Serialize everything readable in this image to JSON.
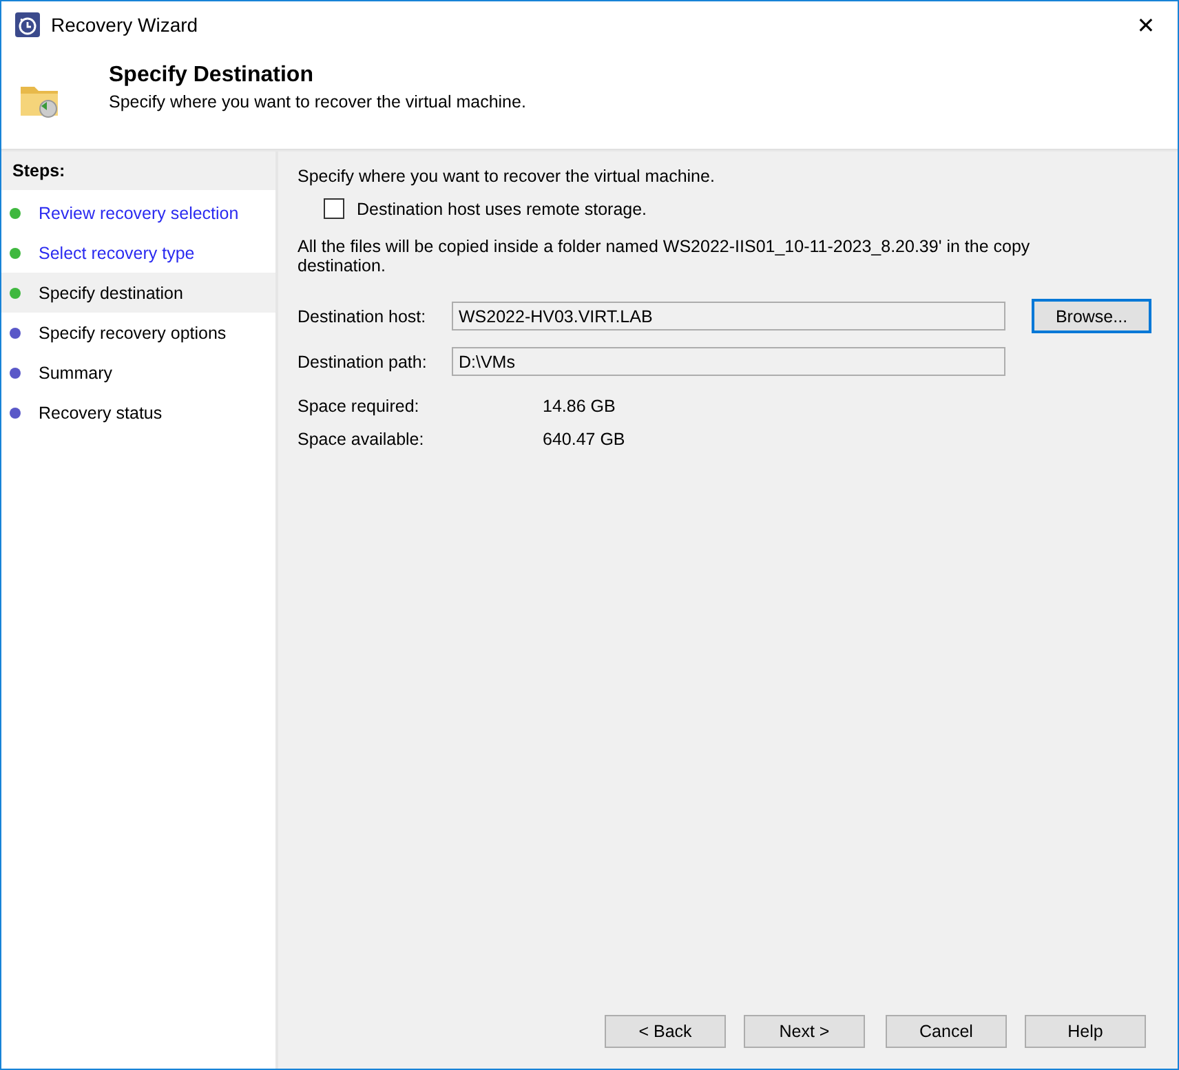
{
  "window": {
    "title": "Recovery Wizard",
    "close": "✕"
  },
  "header": {
    "title": "Specify Destination",
    "subtitle": "Specify where you want to recover the virtual machine."
  },
  "steps": {
    "heading": "Steps:",
    "items": [
      {
        "label": "Review recovery selection",
        "completed": true,
        "selected": false
      },
      {
        "label": "Select recovery type",
        "completed": true,
        "selected": false
      },
      {
        "label": "Specify destination",
        "completed": true,
        "selected": true
      },
      {
        "label": "Specify recovery options",
        "completed": false,
        "selected": false
      },
      {
        "label": "Summary",
        "completed": false,
        "selected": false
      },
      {
        "label": "Recovery status",
        "completed": false,
        "selected": false
      }
    ]
  },
  "content": {
    "intro": "Specify where you want to recover the virtual machine.",
    "remote_storage": {
      "label": "Destination host uses remote storage.",
      "checked": false
    },
    "note": "All the files will be copied inside a folder named  WS2022-IIS01_10-11-2023_8.20.39' in the copy destination.",
    "host": {
      "label": "Destination host:",
      "value": "WS2022-HV03.VIRT.LAB",
      "button": "Browse..."
    },
    "path": {
      "label": "Destination path:",
      "value": "D:\\VMs"
    },
    "space": [
      {
        "label": "Space required:",
        "value": "14.86 GB"
      },
      {
        "label": "Space available:",
        "value": "640.47 GB"
      }
    ]
  },
  "buttons": [
    "< Back",
    "Next >",
    "Cancel",
    "Help"
  ]
}
